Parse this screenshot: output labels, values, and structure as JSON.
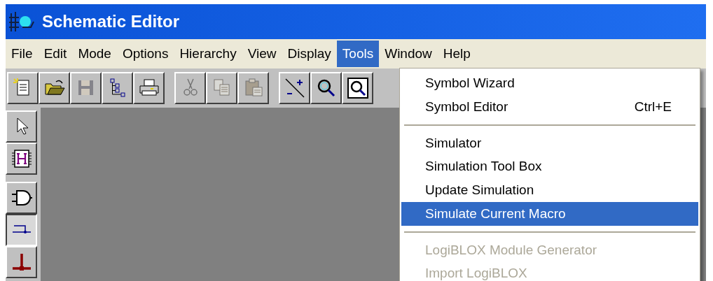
{
  "window": {
    "title": "Schematic Editor"
  },
  "menu_bar": [
    {
      "label": "File",
      "selected": false
    },
    {
      "label": "Edit",
      "selected": false
    },
    {
      "label": "Mode",
      "selected": false
    },
    {
      "label": "Options",
      "selected": false
    },
    {
      "label": "Hierarchy",
      "selected": false
    },
    {
      "label": "View",
      "selected": false
    },
    {
      "label": "Display",
      "selected": false
    },
    {
      "label": "Tools",
      "selected": true
    },
    {
      "label": "Window",
      "selected": false
    },
    {
      "label": "Help",
      "selected": false
    }
  ],
  "toolbar": [
    [
      {
        "kind": "new",
        "disabled": false
      },
      {
        "kind": "open",
        "disabled": false
      },
      {
        "kind": "save",
        "disabled": true
      },
      {
        "kind": "hierarchy",
        "disabled": false
      },
      {
        "kind": "print",
        "disabled": false
      }
    ],
    [
      {
        "kind": "cut",
        "disabled": true
      },
      {
        "kind": "copy",
        "disabled": true
      },
      {
        "kind": "paste",
        "disabled": true
      }
    ],
    [
      {
        "kind": "zoom-line",
        "disabled": false
      },
      {
        "kind": "zoom",
        "disabled": false
      },
      {
        "kind": "zoom-box",
        "disabled": false
      }
    ]
  ],
  "tool_palette": [
    [
      {
        "kind": "select",
        "pressed": false
      },
      {
        "kind": "macro",
        "pressed": false
      }
    ],
    [
      {
        "kind": "gate",
        "pressed": false
      },
      {
        "kind": "net",
        "pressed": true
      },
      {
        "kind": "bus",
        "pressed": false
      }
    ]
  ],
  "tools_menu": [
    {
      "kind": "item",
      "label": "Symbol Wizard",
      "selected": false,
      "disabled": false
    },
    {
      "kind": "item",
      "label": "Symbol Editor",
      "shortcut": "Ctrl+E",
      "selected": false,
      "disabled": false
    },
    {
      "kind": "separator"
    },
    {
      "kind": "item",
      "label": "Simulator",
      "selected": false,
      "disabled": false
    },
    {
      "kind": "item",
      "label": "Simulation Tool Box",
      "selected": false,
      "disabled": false
    },
    {
      "kind": "item",
      "label": "Update Simulation",
      "selected": false,
      "disabled": false
    },
    {
      "kind": "item",
      "label": "Simulate Current Macro",
      "selected": true,
      "disabled": false
    },
    {
      "kind": "separator"
    },
    {
      "kind": "item",
      "label": "LogiBLOX Module Generator",
      "selected": false,
      "disabled": true
    },
    {
      "kind": "item",
      "label": "Import LogiBLOX",
      "selected": false,
      "disabled": true
    }
  ]
}
